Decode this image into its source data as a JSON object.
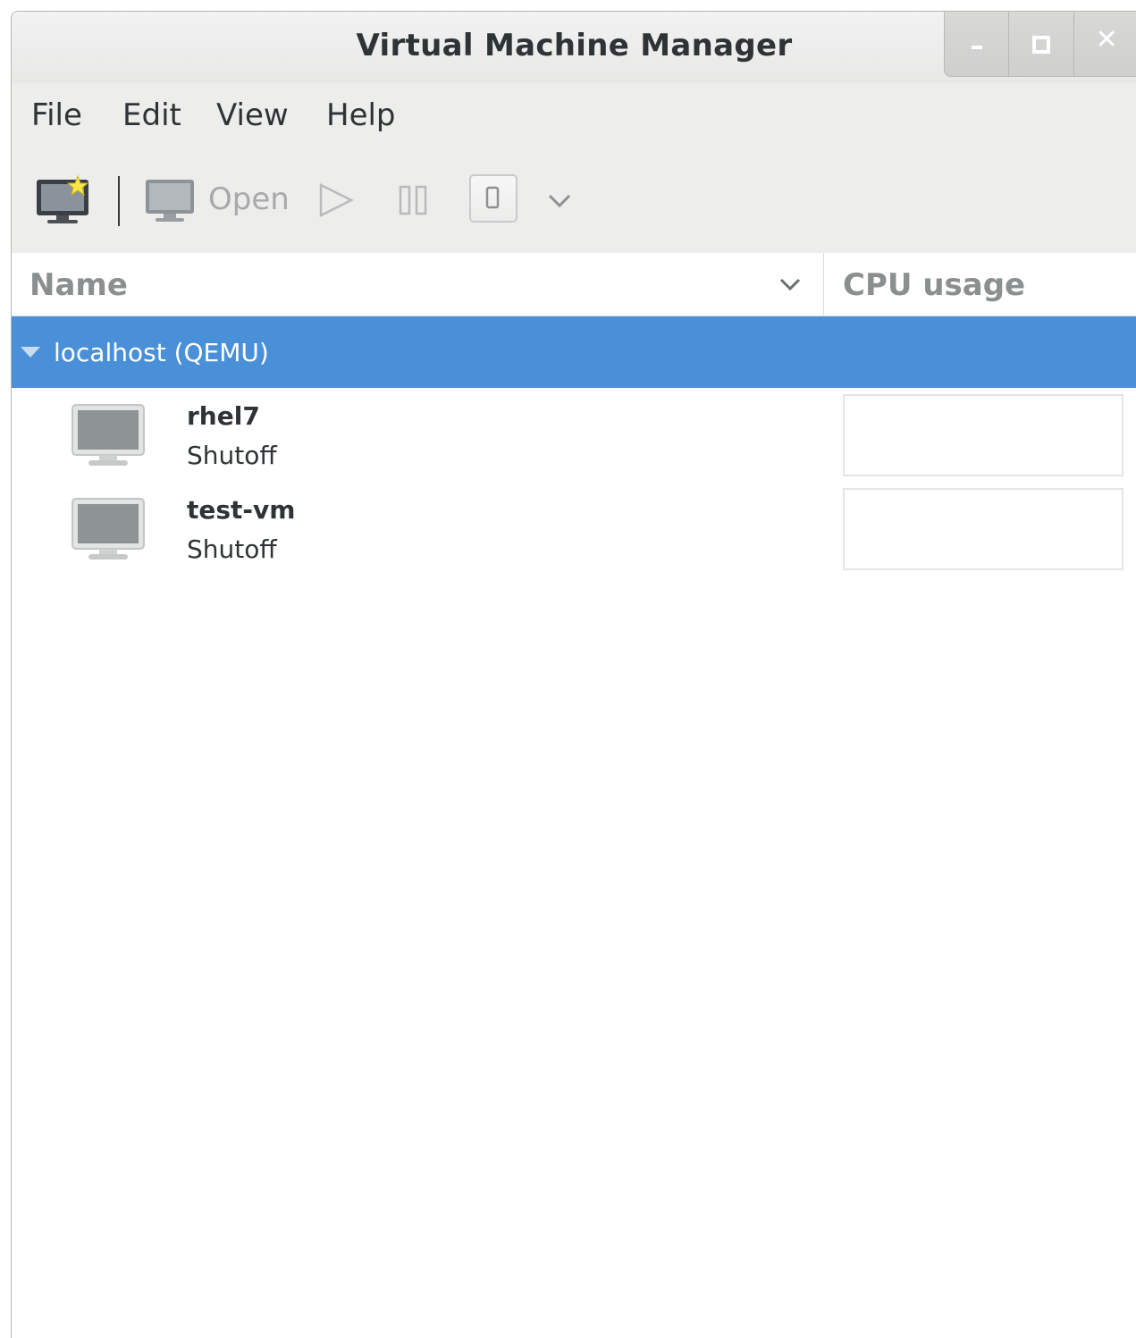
{
  "window": {
    "title": "Virtual Machine Manager"
  },
  "menubar": {
    "items": [
      "File",
      "Edit",
      "View",
      "Help"
    ]
  },
  "toolbar": {
    "new_vm_icon": "new-vm-icon",
    "open_label": "Open",
    "run_icon": "play-icon",
    "pause_icon": "pause-icon",
    "shutdown_icon": "shutdown-icon",
    "menu_icon": "chevron-down-icon"
  },
  "columns": {
    "name": "Name",
    "cpu": "CPU usage"
  },
  "connection": {
    "label": "localhost (QEMU)",
    "expanded": true
  },
  "vms": [
    {
      "name": "rhel7",
      "status": "Shutoff"
    },
    {
      "name": "test-vm",
      "status": "Shutoff"
    }
  ],
  "colors": {
    "selection": "#4a90d9",
    "background": "#ededec"
  }
}
